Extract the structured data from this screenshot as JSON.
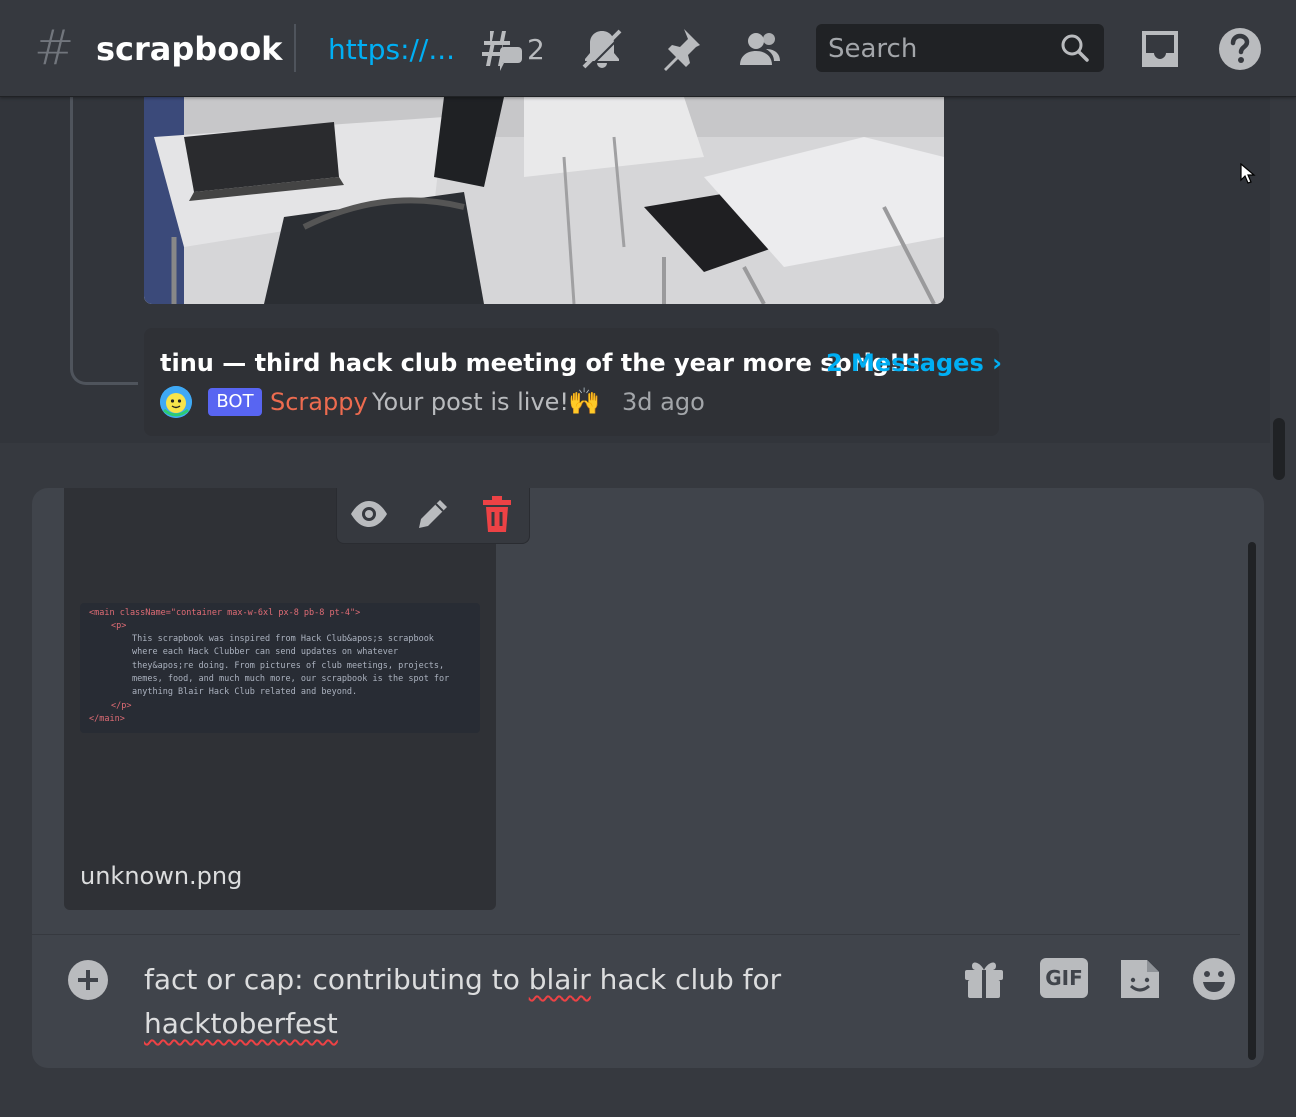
{
  "header": {
    "channel_hash": "#",
    "channel_name": "scrapbook",
    "topic_link": "https://...",
    "thread_count": "2",
    "search_placeholder": "Search",
    "icons": [
      "threads-icon",
      "mute-bell-icon",
      "pin-icon",
      "members-icon",
      "search-icon",
      "inbox-icon",
      "help-icon"
    ]
  },
  "thread": {
    "title": "tinu — third hack club meeting of the year more sprig!!!",
    "messages_link": "2 Messages ›",
    "badge": "BOT",
    "author": "Scrappy",
    "message": "Your post is live!",
    "emoji": "🙌",
    "time": "3d ago"
  },
  "attachment": {
    "filename": "unknown.png",
    "code_lines": [
      "<main className=\"container max-w-6xl px-8 pb-8 pt-4\">",
      "<p>",
      "This scrapbook was inspired from Hack Club&apos;s scrapbook",
      "where each Hack Clubber can send updates on whatever",
      "they&apos;re doing. From pictures of club meetings, projects,",
      "memes, food, and much much more, our scrapbook is the spot for",
      "anything Blair Hack Club related and beyond.",
      "</p>",
      "</main>"
    ],
    "toolbar": [
      "eye-icon",
      "pencil-icon",
      "trash-icon"
    ]
  },
  "composer": {
    "text_before": "fact or cap: contributing to ",
    "misspelled_1": "blair",
    "text_middle": " hack club for ",
    "misspelled_2": "hacktoberfest",
    "gif_label": "GIF"
  },
  "colors": {
    "accent_link": "#00aff4",
    "bot_badge": "#5865f2",
    "bot_name": "#ed6b4f",
    "delete": "#ed4245"
  }
}
